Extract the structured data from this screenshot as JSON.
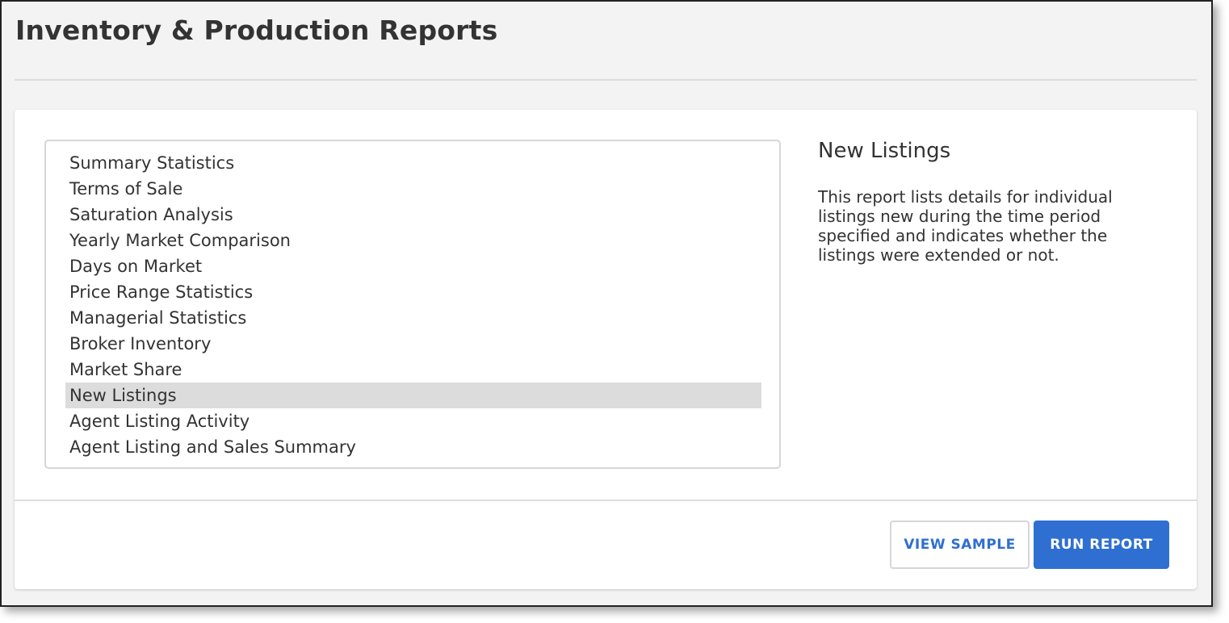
{
  "page": {
    "title": "Inventory & Production Reports"
  },
  "reports": {
    "items": [
      {
        "label": "Summary Statistics"
      },
      {
        "label": "Terms of Sale"
      },
      {
        "label": "Saturation Analysis"
      },
      {
        "label": "Yearly Market Comparison"
      },
      {
        "label": "Days on Market"
      },
      {
        "label": "Price Range Statistics"
      },
      {
        "label": "Managerial Statistics"
      },
      {
        "label": "Broker Inventory"
      },
      {
        "label": "Market Share"
      },
      {
        "label": "New Listings"
      },
      {
        "label": "Agent Listing Activity"
      },
      {
        "label": "Agent Listing and Sales Summary"
      }
    ],
    "selected_label": "New Listings"
  },
  "detail": {
    "title": "New Listings",
    "description": "This report lists details for individual listings new during the time period specified and indicates whether the listings were extended or not."
  },
  "actions": {
    "view_sample_label": "VIEW SAMPLE",
    "run_report_label": "RUN REPORT"
  },
  "colors": {
    "accent": "#2f6fd1",
    "selected_row": "#dcdcdc",
    "background": "#f3f3f3"
  }
}
